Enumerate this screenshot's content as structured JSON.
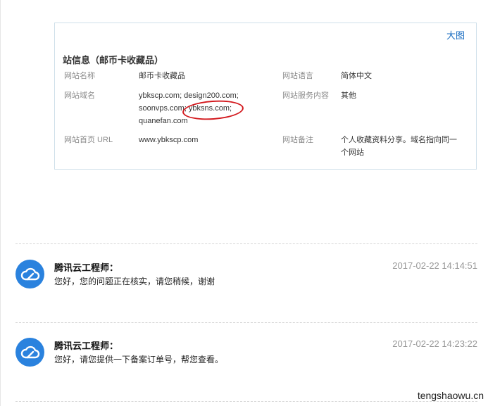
{
  "site_info": {
    "big_image_link": "大图",
    "title": "站信息（邮币卡收藏品）",
    "fields": {
      "name_label": "网站名称",
      "name_value": "邮币卡收藏品",
      "language_label": "网站语言",
      "language_value": "简体中文",
      "domain_label": "网站域名",
      "domain_value": "ybkscp.com; design200.com; soonvps.com; ybksns.com; quanefan.com",
      "service_label": "网站服务内容",
      "service_value": "其他",
      "homepage_label": "网站首页 URL",
      "homepage_value": "www.ybkscp.com",
      "remark_label": "网站备注",
      "remark_value": "个人收藏资料分享。域名指向同一个网站"
    },
    "highlight_mark_color": "#d3191e"
  },
  "messages": [
    {
      "sender": "腾讯云工程师：",
      "text": "您好，您的问题正在核实，请您稍候，谢谢",
      "time": "2017-02-22 14:14:51",
      "avatar_icon": "tencent-cloud-icon"
    },
    {
      "sender": "腾讯云工程师：",
      "text": "您好，请您提供一下备案订单号，帮您查看。",
      "time": "2017-02-22 14:23:22",
      "avatar_icon": "tencent-cloud-icon"
    }
  ],
  "watermark": "tengshaowu.cn",
  "colors": {
    "accent": "#2a82de",
    "link": "#1b6ec2",
    "card_border": "#cfe0ea"
  }
}
